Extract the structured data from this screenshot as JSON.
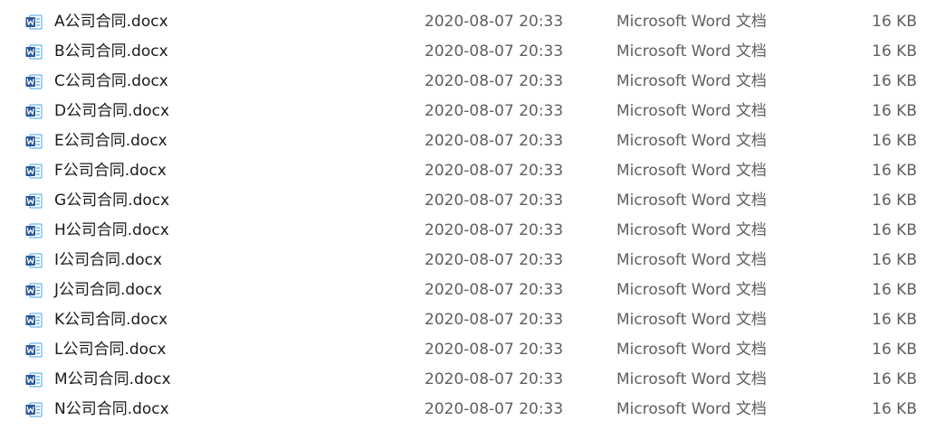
{
  "file_list": {
    "rows": [
      {
        "icon": "word-document-icon",
        "name": "A公司合同.docx",
        "modified": "2020-08-07 20:33",
        "type": "Microsoft Word 文档",
        "size": "16 KB"
      },
      {
        "icon": "word-document-icon",
        "name": "B公司合同.docx",
        "modified": "2020-08-07 20:33",
        "type": "Microsoft Word 文档",
        "size": "16 KB"
      },
      {
        "icon": "word-document-icon",
        "name": "C公司合同.docx",
        "modified": "2020-08-07 20:33",
        "type": "Microsoft Word 文档",
        "size": "16 KB"
      },
      {
        "icon": "word-document-icon",
        "name": "D公司合同.docx",
        "modified": "2020-08-07 20:33",
        "type": "Microsoft Word 文档",
        "size": "16 KB"
      },
      {
        "icon": "word-document-icon",
        "name": "E公司合同.docx",
        "modified": "2020-08-07 20:33",
        "type": "Microsoft Word 文档",
        "size": "16 KB"
      },
      {
        "icon": "word-document-icon",
        "name": "F公司合同.docx",
        "modified": "2020-08-07 20:33",
        "type": "Microsoft Word 文档",
        "size": "16 KB"
      },
      {
        "icon": "word-document-icon",
        "name": "G公司合同.docx",
        "modified": "2020-08-07 20:33",
        "type": "Microsoft Word 文档",
        "size": "16 KB"
      },
      {
        "icon": "word-document-icon",
        "name": "H公司合同.docx",
        "modified": "2020-08-07 20:33",
        "type": "Microsoft Word 文档",
        "size": "16 KB"
      },
      {
        "icon": "word-document-icon",
        "name": "I公司合同.docx",
        "modified": "2020-08-07 20:33",
        "type": "Microsoft Word 文档",
        "size": "16 KB"
      },
      {
        "icon": "word-document-icon",
        "name": "J公司合同.docx",
        "modified": "2020-08-07 20:33",
        "type": "Microsoft Word 文档",
        "size": "16 KB"
      },
      {
        "icon": "word-document-icon",
        "name": "K公司合同.docx",
        "modified": "2020-08-07 20:33",
        "type": "Microsoft Word 文档",
        "size": "16 KB"
      },
      {
        "icon": "word-document-icon",
        "name": "L公司合同.docx",
        "modified": "2020-08-07 20:33",
        "type": "Microsoft Word 文档",
        "size": "16 KB"
      },
      {
        "icon": "word-document-icon",
        "name": "M公司合同.docx",
        "modified": "2020-08-07 20:33",
        "type": "Microsoft Word 文档",
        "size": "16 KB"
      },
      {
        "icon": "word-document-icon",
        "name": "N公司合同.docx",
        "modified": "2020-08-07 20:33",
        "type": "Microsoft Word 文档",
        "size": "16 KB"
      }
    ]
  },
  "colors": {
    "word_blue": "#2b579a",
    "word_blue_light": "#41a5ee",
    "name_text": "#1a1a1a",
    "detail_text": "#5f5f5f"
  }
}
